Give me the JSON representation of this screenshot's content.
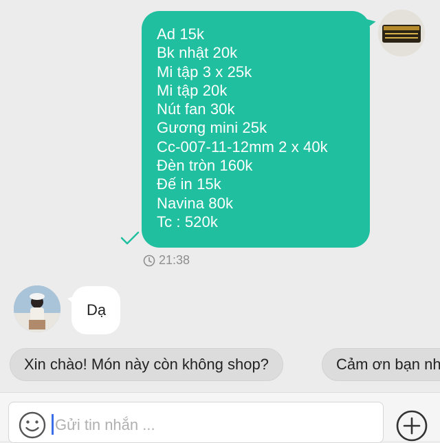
{
  "conversation": {
    "sent_message": {
      "lines": [
        "Ad 15k",
        "Bk nhật 20k",
        "Mi tập 3 x 25k",
        "Mi tập 20k",
        "Nút fan 30k",
        "Gương mini 25k",
        "Cc-007-11-12mm 2 x 40k",
        "Đèn tròn 160k",
        "Đế in 15k",
        "Navina 80k",
        "Tc : 520k"
      ],
      "time": "21:38",
      "status_icon": "check-icon"
    },
    "received_message": {
      "text": "Dạ"
    }
  },
  "quick_replies": [
    "Xin chào! Món này còn không shop?",
    "Cảm ơn bạn nhé"
  ],
  "composer": {
    "placeholder": "Gửi tin nhắn ..."
  },
  "colors": {
    "sent_bubble": "#1fbf9f",
    "background": "#ececec",
    "chip": "#dcdcdc",
    "caret": "#3a6ee8"
  },
  "icons": [
    "check-icon",
    "clock-icon",
    "emoji-icon",
    "plus-icon"
  ]
}
